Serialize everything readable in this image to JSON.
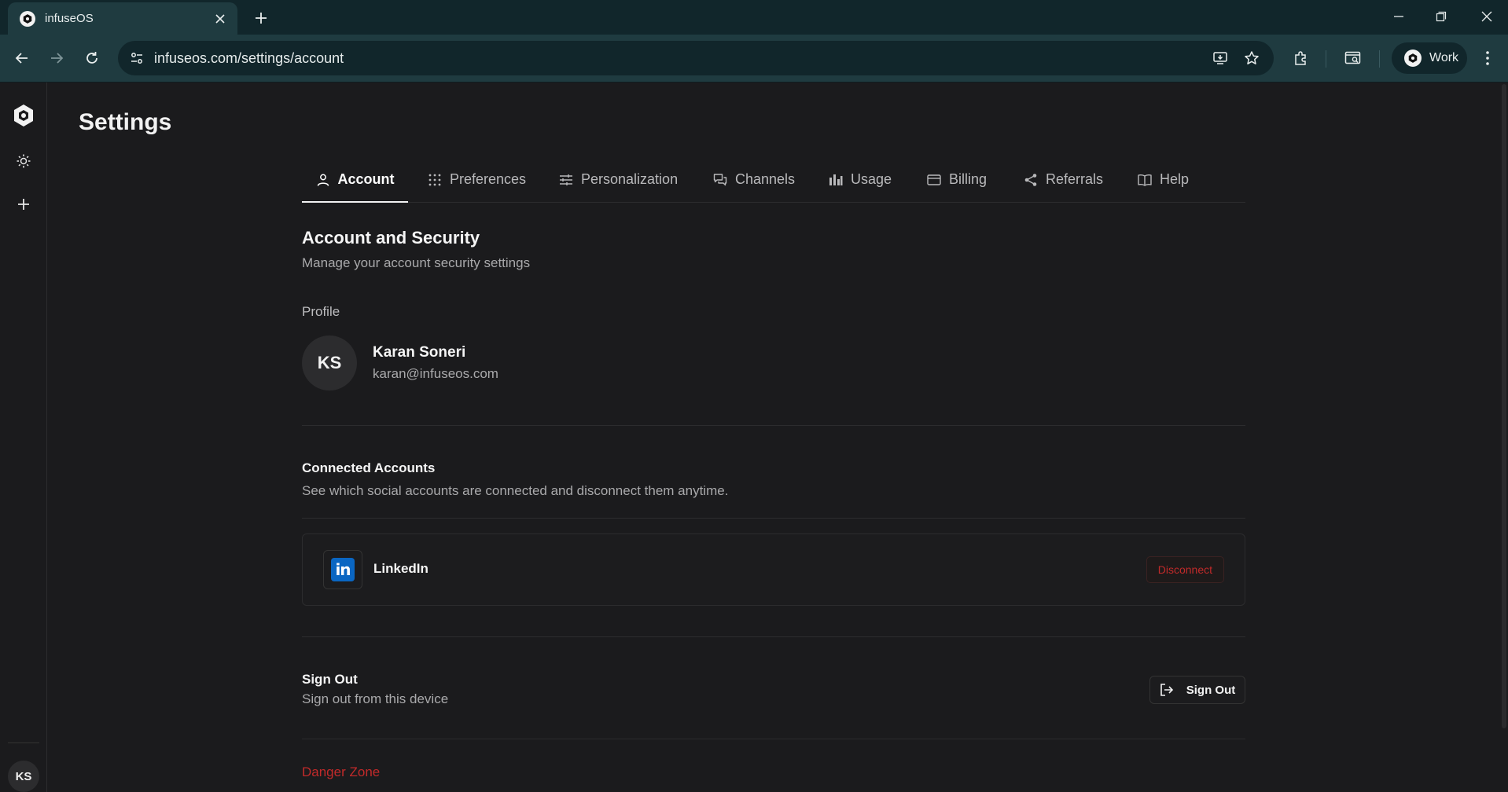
{
  "browser": {
    "tab_title": "infuseOS",
    "url": "infuseos.com/settings/account",
    "profile_label": "Work"
  },
  "sidebar": {
    "avatar_initials": "KS"
  },
  "page": {
    "title": "Settings"
  },
  "tabs": [
    {
      "label": "Account",
      "icon": "user-icon",
      "active": true
    },
    {
      "label": "Preferences",
      "icon": "grid-icon"
    },
    {
      "label": "Personalization",
      "icon": "sliders-icon"
    },
    {
      "label": "Channels",
      "icon": "chat-icon"
    },
    {
      "label": "Usage",
      "icon": "bar-chart-icon"
    },
    {
      "label": "Billing",
      "icon": "card-icon"
    },
    {
      "label": "Referrals",
      "icon": "share-icon"
    },
    {
      "label": "Help",
      "icon": "book-icon"
    }
  ],
  "account": {
    "heading": "Account and Security",
    "subheading": "Manage your account security settings",
    "profile_label": "Profile",
    "initials": "KS",
    "name": "Karan Soneri",
    "email": "karan@infuseos.com"
  },
  "connected": {
    "title": "Connected Accounts",
    "subtitle": "See which social accounts are connected and disconnect them anytime.",
    "accounts": [
      {
        "name": "LinkedIn",
        "logo_text": "in",
        "brand_color": "#0a66c2",
        "action": "Disconnect"
      }
    ]
  },
  "signout": {
    "title": "Sign Out",
    "subtitle": "Sign out from this device",
    "button": "Sign Out"
  },
  "danger": {
    "title": "Danger Zone",
    "color": "#c22a2a"
  }
}
